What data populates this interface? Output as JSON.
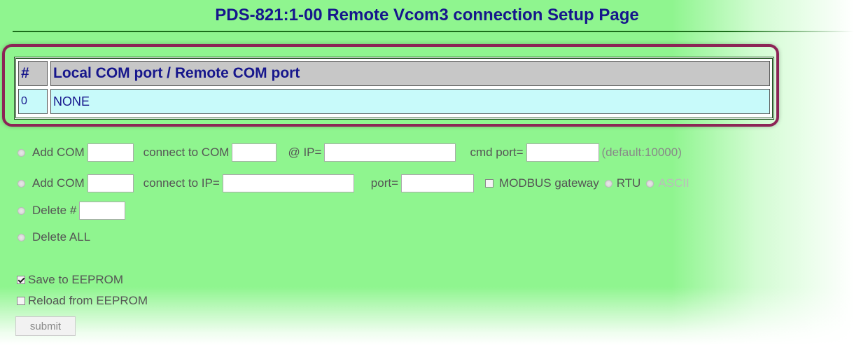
{
  "page": {
    "title": "PDS-821:1-00 Remote Vcom3 connection Setup Page"
  },
  "table": {
    "headers": {
      "num": "#",
      "port": "Local COM port / Remote COM port"
    },
    "rows": [
      {
        "num": "0",
        "port": "NONE"
      }
    ]
  },
  "options": {
    "add_com_to_com": {
      "add_label": "Add COM",
      "connect_label": "connect to COM",
      "ip_label": "@ IP=",
      "cmd_port_label": "cmd port=",
      "default_note": "(default:10000)"
    },
    "add_com_to_ip": {
      "add_label": "Add COM",
      "connect_label": "connect to IP=",
      "port_label": "port=",
      "modbus_label": "MODBUS gateway",
      "rtu_label": "RTU",
      "ascii_label": "ASCII"
    },
    "delete_one": {
      "label": "Delete #"
    },
    "delete_all": {
      "label": "Delete ALL"
    }
  },
  "eeprom": {
    "save_label": "Save to EEPROM",
    "save_checked": true,
    "reload_label": "Reload from EEPROM",
    "reload_checked": false
  },
  "submit": {
    "label": "submit"
  },
  "colors": {
    "background": "#8ff58f",
    "title": "#16168c",
    "highlight_border": "#8c2456",
    "table_header_bg": "#c7c7c7",
    "table_row_bg": "#c8fafa"
  }
}
